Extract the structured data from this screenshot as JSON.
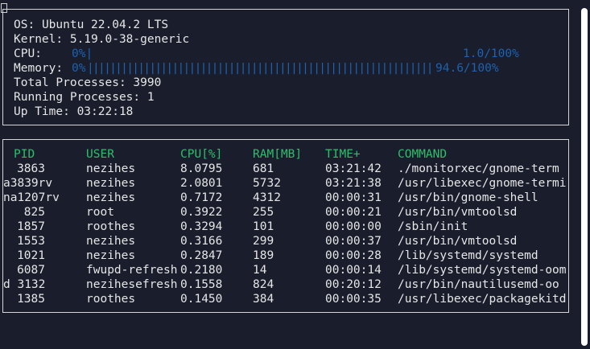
{
  "system": {
    "os_label": "OS:",
    "os_value": "Ubuntu 22.04.2 LTS",
    "kernel_label": "Kernel:",
    "kernel_value": "5.19.0-38-generic",
    "cpu_label": "CPU:",
    "cpu_left": "0%|",
    "cpu_percent": 1.0,
    "cpu_right": "1.0/100%",
    "memory_label": "Memory:",
    "memory_left": "0%",
    "memory_percent": 94.6,
    "memory_right": "94.6/100%",
    "total_processes": "Total Processes: 3990",
    "running_processes": "Running Processes: 1",
    "uptime": "Up Time: 03:22:18"
  },
  "table": {
    "headers": [
      "PID",
      "USER",
      "CPU[%]",
      "RAM[MB]",
      "TIME+",
      "COMMAND"
    ],
    "rows": [
      {
        "pid": "3863",
        "user": "nezihes",
        "cpu": "8.0795",
        "ram": "681",
        "time": "03:21:42",
        "command": "./monitorxec/gnome-term"
      },
      {
        "pid": "a3839rv",
        "user": "nezihes",
        "cpu": "2.0801",
        "ram": "5732",
        "time": "03:21:38",
        "command": "/usr/libexec/gnome-termi"
      },
      {
        "pid": "na1207rv",
        "user": "nezihes",
        "cpu": "0.7172",
        "ram": "4312",
        "time": "00:00:31",
        "command": "/usr/bin/gnome-shell"
      },
      {
        "pid": "825",
        "user": "root",
        "cpu": "0.3922",
        "ram": "255",
        "time": "00:00:21",
        "command": "/usr/bin/vmtoolsd"
      },
      {
        "pid": "1857",
        "user": "roothes",
        "cpu": "0.3294",
        "ram": "101",
        "time": "00:00:00",
        "command": "/sbin/init"
      },
      {
        "pid": "1553",
        "user": "nezihes",
        "cpu": "0.3166",
        "ram": "299",
        "time": "00:00:37",
        "command": "/usr/bin/vmtoolsd"
      },
      {
        "pid": "1021",
        "user": "nezihes",
        "cpu": "0.2847",
        "ram": "189",
        "time": "00:00:28",
        "command": "/lib/systemd/systemd"
      },
      {
        "pid": "6087",
        "user": "fwupd-refresh",
        "cpu": "0.2180",
        "ram": "14",
        "time": "00:00:14",
        "command": "/lib/systemd/systemd-oom"
      },
      {
        "pid": "d 3132",
        "user": "nezihesefresh",
        "cpu": "0.1558",
        "ram": "824",
        "time": "00:20:12",
        "command": "/usr/bin/nautilusemd-oo"
      },
      {
        "pid": "1385",
        "user": "roothes",
        "cpu": "0.1450",
        "ram": "384",
        "time": "00:00:35",
        "command": "/usr/libexec/packagekitd"
      }
    ]
  },
  "colors": {
    "background": "#191d2c",
    "text": "#e6e6e6",
    "bar": "#1e62b0",
    "header": "#2fbf6a",
    "border": "#d6d6d6"
  }
}
